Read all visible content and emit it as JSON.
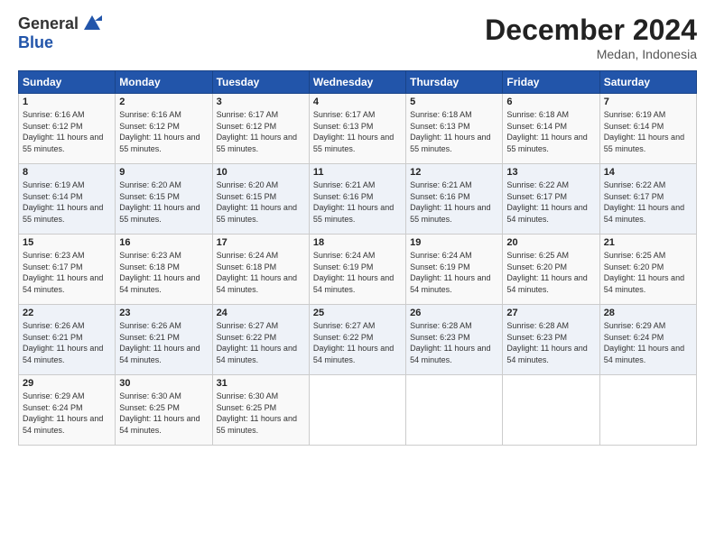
{
  "logo": {
    "general": "General",
    "blue": "Blue"
  },
  "header": {
    "month": "December 2024",
    "location": "Medan, Indonesia"
  },
  "days_of_week": [
    "Sunday",
    "Monday",
    "Tuesday",
    "Wednesday",
    "Thursday",
    "Friday",
    "Saturday"
  ],
  "weeks": [
    [
      {
        "day": "1",
        "sunrise": "6:16 AM",
        "sunset": "6:12 PM",
        "daylight": "11 hours and 55 minutes."
      },
      {
        "day": "2",
        "sunrise": "6:16 AM",
        "sunset": "6:12 PM",
        "daylight": "11 hours and 55 minutes."
      },
      {
        "day": "3",
        "sunrise": "6:17 AM",
        "sunset": "6:12 PM",
        "daylight": "11 hours and 55 minutes."
      },
      {
        "day": "4",
        "sunrise": "6:17 AM",
        "sunset": "6:13 PM",
        "daylight": "11 hours and 55 minutes."
      },
      {
        "day": "5",
        "sunrise": "6:18 AM",
        "sunset": "6:13 PM",
        "daylight": "11 hours and 55 minutes."
      },
      {
        "day": "6",
        "sunrise": "6:18 AM",
        "sunset": "6:14 PM",
        "daylight": "11 hours and 55 minutes."
      },
      {
        "day": "7",
        "sunrise": "6:19 AM",
        "sunset": "6:14 PM",
        "daylight": "11 hours and 55 minutes."
      }
    ],
    [
      {
        "day": "8",
        "sunrise": "6:19 AM",
        "sunset": "6:14 PM",
        "daylight": "11 hours and 55 minutes."
      },
      {
        "day": "9",
        "sunrise": "6:20 AM",
        "sunset": "6:15 PM",
        "daylight": "11 hours and 55 minutes."
      },
      {
        "day": "10",
        "sunrise": "6:20 AM",
        "sunset": "6:15 PM",
        "daylight": "11 hours and 55 minutes."
      },
      {
        "day": "11",
        "sunrise": "6:21 AM",
        "sunset": "6:16 PM",
        "daylight": "11 hours and 55 minutes."
      },
      {
        "day": "12",
        "sunrise": "6:21 AM",
        "sunset": "6:16 PM",
        "daylight": "11 hours and 55 minutes."
      },
      {
        "day": "13",
        "sunrise": "6:22 AM",
        "sunset": "6:17 PM",
        "daylight": "11 hours and 54 minutes."
      },
      {
        "day": "14",
        "sunrise": "6:22 AM",
        "sunset": "6:17 PM",
        "daylight": "11 hours and 54 minutes."
      }
    ],
    [
      {
        "day": "15",
        "sunrise": "6:23 AM",
        "sunset": "6:17 PM",
        "daylight": "11 hours and 54 minutes."
      },
      {
        "day": "16",
        "sunrise": "6:23 AM",
        "sunset": "6:18 PM",
        "daylight": "11 hours and 54 minutes."
      },
      {
        "day": "17",
        "sunrise": "6:24 AM",
        "sunset": "6:18 PM",
        "daylight": "11 hours and 54 minutes."
      },
      {
        "day": "18",
        "sunrise": "6:24 AM",
        "sunset": "6:19 PM",
        "daylight": "11 hours and 54 minutes."
      },
      {
        "day": "19",
        "sunrise": "6:24 AM",
        "sunset": "6:19 PM",
        "daylight": "11 hours and 54 minutes."
      },
      {
        "day": "20",
        "sunrise": "6:25 AM",
        "sunset": "6:20 PM",
        "daylight": "11 hours and 54 minutes."
      },
      {
        "day": "21",
        "sunrise": "6:25 AM",
        "sunset": "6:20 PM",
        "daylight": "11 hours and 54 minutes."
      }
    ],
    [
      {
        "day": "22",
        "sunrise": "6:26 AM",
        "sunset": "6:21 PM",
        "daylight": "11 hours and 54 minutes."
      },
      {
        "day": "23",
        "sunrise": "6:26 AM",
        "sunset": "6:21 PM",
        "daylight": "11 hours and 54 minutes."
      },
      {
        "day": "24",
        "sunrise": "6:27 AM",
        "sunset": "6:22 PM",
        "daylight": "11 hours and 54 minutes."
      },
      {
        "day": "25",
        "sunrise": "6:27 AM",
        "sunset": "6:22 PM",
        "daylight": "11 hours and 54 minutes."
      },
      {
        "day": "26",
        "sunrise": "6:28 AM",
        "sunset": "6:23 PM",
        "daylight": "11 hours and 54 minutes."
      },
      {
        "day": "27",
        "sunrise": "6:28 AM",
        "sunset": "6:23 PM",
        "daylight": "11 hours and 54 minutes."
      },
      {
        "day": "28",
        "sunrise": "6:29 AM",
        "sunset": "6:24 PM",
        "daylight": "11 hours and 54 minutes."
      }
    ],
    [
      {
        "day": "29",
        "sunrise": "6:29 AM",
        "sunset": "6:24 PM",
        "daylight": "11 hours and 54 minutes."
      },
      {
        "day": "30",
        "sunrise": "6:30 AM",
        "sunset": "6:25 PM",
        "daylight": "11 hours and 54 minutes."
      },
      {
        "day": "31",
        "sunrise": "6:30 AM",
        "sunset": "6:25 PM",
        "daylight": "11 hours and 55 minutes."
      },
      null,
      null,
      null,
      null
    ]
  ]
}
